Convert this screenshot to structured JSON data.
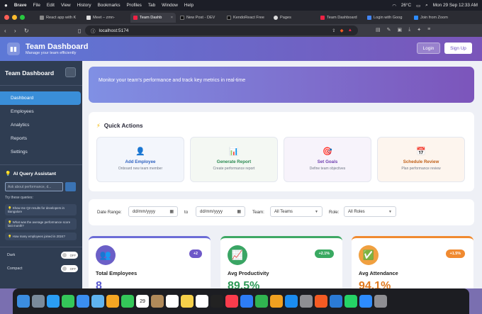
{
  "menubar": {
    "items": [
      "Brave",
      "File",
      "Edit",
      "View",
      "History",
      "Bookmarks",
      "Profiles",
      "Tab",
      "Window",
      "Help"
    ],
    "weather": "26°C",
    "datetime": "Mon 29 Sep  12:33 AM"
  },
  "tabs": [
    {
      "label": "React app with K"
    },
    {
      "label": "Meet – zmn-"
    },
    {
      "label": "Team Dashb",
      "active": true
    },
    {
      "label": "New Post - DEV"
    },
    {
      "label": "KendoReact Free"
    },
    {
      "label": "Pages"
    },
    {
      "label": "Team Dashboard"
    },
    {
      "label": "Login with Goog"
    },
    {
      "label": "Join from Zoom"
    }
  ],
  "address": {
    "url": "localhost:5174"
  },
  "header": {
    "title": "Team Dashboard",
    "subtitle": "Manage your team efficiently",
    "logo_icon": "chart-icon",
    "login": "Login",
    "signup": "Sign Up"
  },
  "sidebar": {
    "title": "Team Dashboard",
    "items": [
      {
        "label": "Dashboard",
        "active": true
      },
      {
        "label": "Employees"
      },
      {
        "label": "Analytics"
      },
      {
        "label": "Reports"
      },
      {
        "label": "Settings"
      }
    ],
    "ai_title": "AI Query Assistant",
    "ai_placeholder": "Ask about performance, d...",
    "try_label": "Try these queries:",
    "queries": [
      "💡 Show me Q2 results for developers in Bangalore",
      "💡 What was the average performance score last month?",
      "💡 How many employees joined in 2024?"
    ],
    "dark_label": "Dark",
    "dark_state": "OFF",
    "compact_label": "Compact",
    "compact_state": "OFF"
  },
  "hero": {
    "text": "Monitor your team's performance and track key metrics in real-time"
  },
  "quick_actions": {
    "title": "Quick Actions",
    "cards": [
      {
        "icon": "👤",
        "title": "Add Employee",
        "desc": "Onboard new team member",
        "color": "#2f62c0",
        "bg": "#f3f6fc"
      },
      {
        "icon": "📊",
        "title": "Generate Report",
        "desc": "Create performance report",
        "color": "#2c8a52",
        "bg": "#f4f8f3"
      },
      {
        "icon": "🎯",
        "title": "Set Goals",
        "desc": "Define team objectives",
        "color": "#7040b0",
        "bg": "#f7f3fb"
      },
      {
        "icon": "📅",
        "title": "Schedule Review",
        "desc": "Plan performance review",
        "color": "#c06018",
        "bg": "#fdf5ee"
      }
    ]
  },
  "filters": {
    "date_label": "Date Range:",
    "from": "dd/mm/yyyy",
    "to_label": "to",
    "to": "dd/mm/yyyy",
    "team_label": "Team:",
    "team_value": "All Teams",
    "role_label": "Role:",
    "role_value": "All Roles"
  },
  "stats": [
    {
      "icon": "👥",
      "title": "Total Employees",
      "badge": "+2",
      "value": "8",
      "color": "#6c6cd6",
      "badge_color": "#6e58c8",
      "value_color": "#5a5ad0"
    },
    {
      "icon": "📈",
      "title": "Avg Productivity",
      "badge": "+2.1%",
      "value": "89.5%",
      "color": "#3ea864",
      "badge_color": "#39a961",
      "value_color": "#2f9a58"
    },
    {
      "icon": "✅",
      "title": "Avg Attendance",
      "badge": "+1.5%",
      "value": "94.1%",
      "color": "#f08a30",
      "badge_color": "#f08a30",
      "value_color": "#e07a20"
    }
  ],
  "dock": {
    "apps": [
      "finder-icon",
      "launchpad-icon",
      "safari-icon",
      "messages-icon",
      "mail-icon",
      "maps-icon",
      "photos-icon",
      "facetime-icon",
      "calendar-icon",
      "contacts-icon",
      "reminders-icon",
      "notes-icon",
      "freeform-icon",
      "tv-icon",
      "music-icon",
      "keynote-icon",
      "numbers-icon",
      "pages-icon",
      "appstore-icon",
      "settings-icon",
      "brave-icon",
      "vscode-icon",
      "whatsapp-icon",
      "zoom-icon",
      "trash-icon"
    ],
    "calendar_day": "29"
  }
}
